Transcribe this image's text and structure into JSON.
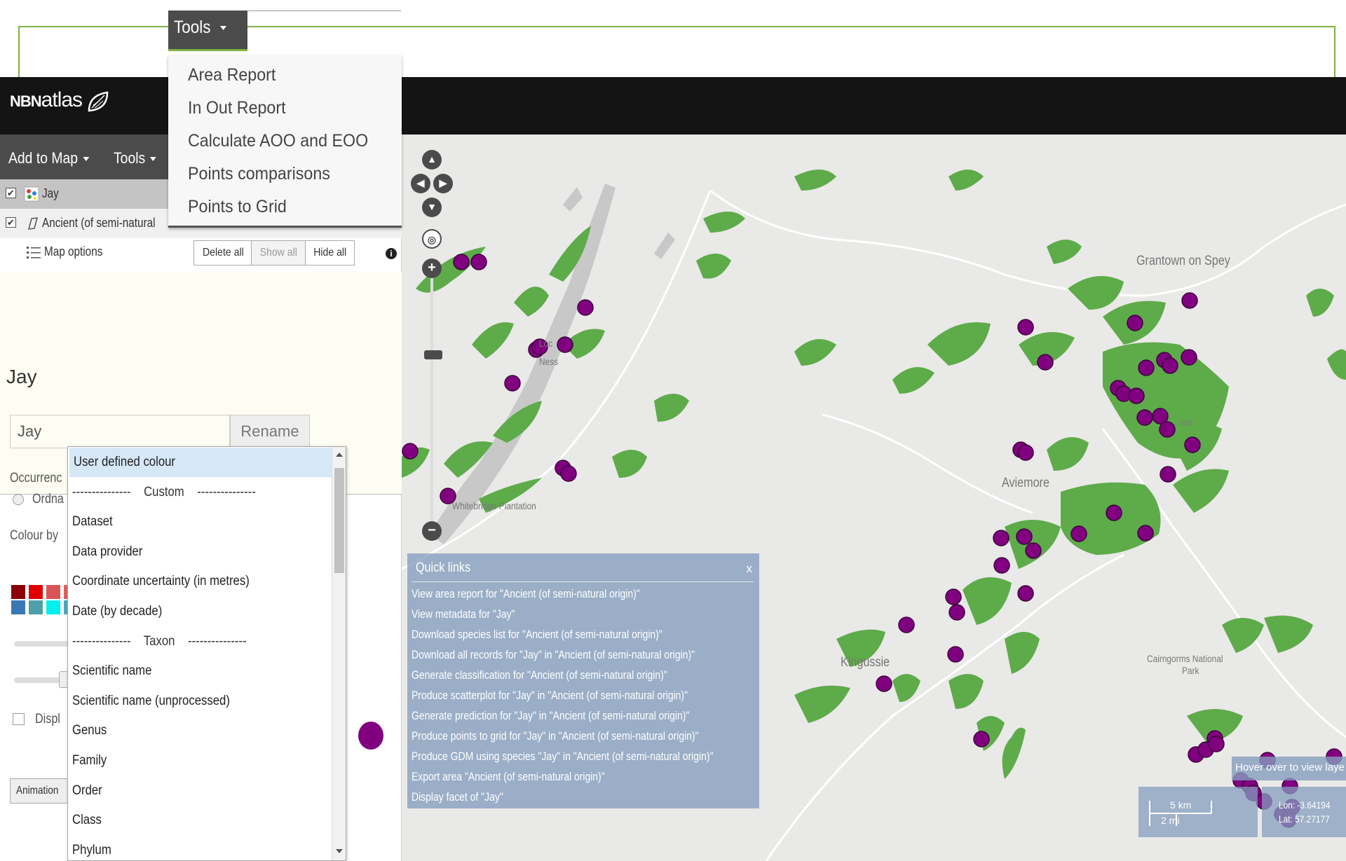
{
  "brand": {
    "nbn": "NBN",
    "atlas": "atlas"
  },
  "tools_popup": {
    "tab_label": "Tools",
    "items": [
      "Area Report",
      "In Out Report",
      "Calculate AOO and EOO",
      "Points comparisons",
      "Points to Grid"
    ]
  },
  "menubar": {
    "add_to_map": "Add to Map",
    "tools": "Tools"
  },
  "layers": [
    {
      "label": "Jay",
      "checked": true
    },
    {
      "label": "Ancient (of semi-natural",
      "checked": true
    }
  ],
  "layer_actions": {
    "map_options": "Map options",
    "delete_all": "Delete all",
    "show_all": "Show all",
    "hide_all": "Hide all"
  },
  "species_panel": {
    "title": "Jay",
    "name_value": "Jay",
    "rename": "Rename",
    "occurrences_label": "Occurrenc",
    "ordnance_label": "Ordna",
    "colour_by_label": "Colour by",
    "display_label": "Displ",
    "animation_label": "Animation"
  },
  "colour_dropdown": {
    "options": [
      {
        "label": "User defined colour",
        "type": "selected"
      },
      {
        "label": "---------------    Custom    ---------------",
        "type": "group"
      },
      {
        "label": "Dataset",
        "type": "option"
      },
      {
        "label": "Data provider",
        "type": "option"
      },
      {
        "label": "Coordinate uncertainty (in metres)",
        "type": "option"
      },
      {
        "label": "Date (by decade)",
        "type": "option"
      },
      {
        "label": "---------------    Taxon    ---------------",
        "type": "group"
      },
      {
        "label": "Scientific name",
        "type": "option"
      },
      {
        "label": "Scientific name (unprocessed)",
        "type": "option"
      },
      {
        "label": "Genus",
        "type": "option"
      },
      {
        "label": "Family",
        "type": "option"
      },
      {
        "label": "Order",
        "type": "option"
      },
      {
        "label": "Class",
        "type": "option"
      },
      {
        "label": "Phylum",
        "type": "option"
      }
    ]
  },
  "colors": {
    "point": "#800080",
    "woodland": "#5eab4a",
    "water": "#c8c8c8",
    "header": "#141414",
    "menubar": "#4b4b4b"
  },
  "map_labels": {
    "grantown": "Grantown on Spey",
    "aviemore": "Aviemore",
    "kingussie": "Kingussie",
    "cairngorms": "Cairngorms National",
    "cairngorms2": "Park",
    "whitebridge": "Whitebridge Plantation",
    "loch": "Loc",
    "ness": "Ness",
    "forest": "rest"
  },
  "quick_links": {
    "title": "Quick links",
    "close": "x",
    "links": [
      "View area report for \"Ancient (of semi-natural origin)\"",
      "View metadata for \"Jay\"",
      "Download species list for \"Ancient (of semi-natural origin)\"",
      "Download all records for \"Jay\" in \"Ancient (of semi-natural origin)\"",
      "Generate classification for \"Ancient (of semi-natural origin)\"",
      "Produce scatterplot for \"Jay\" in \"Ancient (of semi-natural origin)\"",
      "Generate prediction for \"Jay\" in \"Ancient (of semi-natural origin)\"",
      "Produce points to grid for \"Jay\" in \"Ancient (of semi-natural origin)\"",
      "Produce GDM using species \"Jay\" in \"Ancient (of semi-natural origin)\"",
      "Export area \"Ancient (of semi-natural origin)\"",
      "Display facet of \"Jay\""
    ]
  },
  "scale": {
    "km": "5 km",
    "mi": "2 mi"
  },
  "coords": {
    "lon": "Lon: -3.64194",
    "lat": "Lat: 57.27177"
  },
  "hover_tip": "Hover over to view laye"
}
